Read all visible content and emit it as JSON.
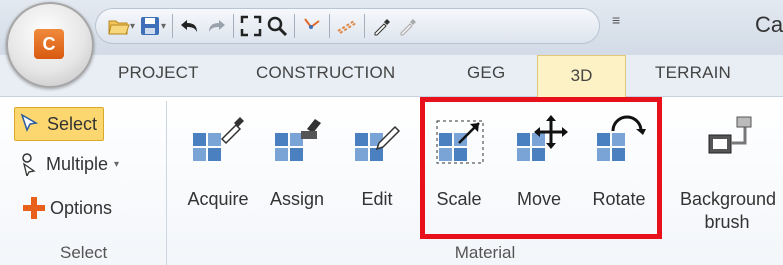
{
  "app": {
    "logo_letter": "C",
    "title_fragment": "Ca",
    "qat_icons": [
      "open-folder-icon",
      "save-icon",
      "undo-icon",
      "redo-icon",
      "zoom-extents-icon",
      "zoom-icon",
      "snap-icon",
      "layers-icon",
      "eyedropper-icon",
      "eyedropper-disabled-icon",
      "customize-qat-icon"
    ],
    "qat_customize_glyph": "≡"
  },
  "tabs": [
    {
      "label": "PROJECT"
    },
    {
      "label": "CONSTRUCTION"
    },
    {
      "label": "GEG"
    },
    {
      "label": "3D",
      "active": true
    },
    {
      "label": "TERRAIN"
    }
  ],
  "ribbon": {
    "select_group": {
      "label": "Select",
      "items": [
        {
          "label": "Select",
          "icon": "cursor-icon",
          "active": true
        },
        {
          "label": "Multiple",
          "icon": "multiple-select-icon",
          "dropdown": true
        },
        {
          "label": "Options",
          "icon": "plus-icon"
        }
      ]
    },
    "material_group": {
      "label": "Material",
      "buttons": [
        {
          "label": "Acquire",
          "icon": "material-acquire-icon"
        },
        {
          "label": "Assign",
          "icon": "material-assign-icon"
        },
        {
          "label": "Edit",
          "icon": "material-edit-icon"
        },
        {
          "label": "Scale",
          "icon": "material-scale-icon"
        },
        {
          "label": "Move",
          "icon": "material-move-icon"
        },
        {
          "label": "Rotate",
          "icon": "material-rotate-icon"
        }
      ]
    },
    "background": {
      "label_line1": "Background",
      "label_line2": "brush",
      "icon": "background-brush-icon"
    }
  },
  "colors": {
    "highlight": "#e8101a",
    "active_tab": "#fdf1c6",
    "active_button": "#fcd770",
    "tile_blue": "#4a7fc0"
  }
}
